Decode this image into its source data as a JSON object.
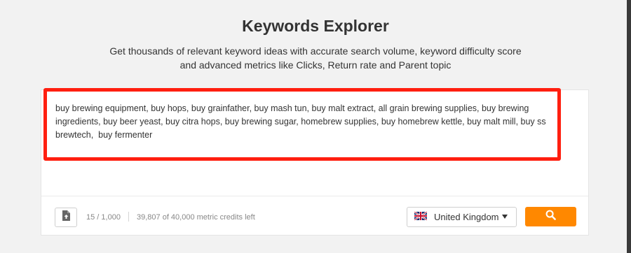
{
  "header": {
    "title": "Keywords Explorer",
    "subtitle_line1": "Get thousands of relevant keyword ideas with accurate search volume, keyword difficulty score",
    "subtitle_line2": "and advanced metrics like Clicks, Return rate and Parent topic"
  },
  "input": {
    "value": "buy brewing equipment, buy hops, buy grainfather, buy mash tun, buy malt extract, all grain brewing supplies, buy brewing ingredients, buy beer yeast, buy citra hops, buy brewing sugar, homebrew supplies, buy homebrew kettle, buy malt mill, buy ss brewtech,  buy fermenter"
  },
  "toolbar": {
    "keyword_count": "15 / 1,000",
    "credits": "39,807 of 40,000 metric credits left",
    "upload_icon": "file-upload-icon",
    "search_icon": "search-icon"
  },
  "country": {
    "selected": "United Kingdom",
    "flag_icon": "uk-flag-icon"
  },
  "colors": {
    "accent": "#ff8800",
    "highlight": "#ff1f10"
  }
}
